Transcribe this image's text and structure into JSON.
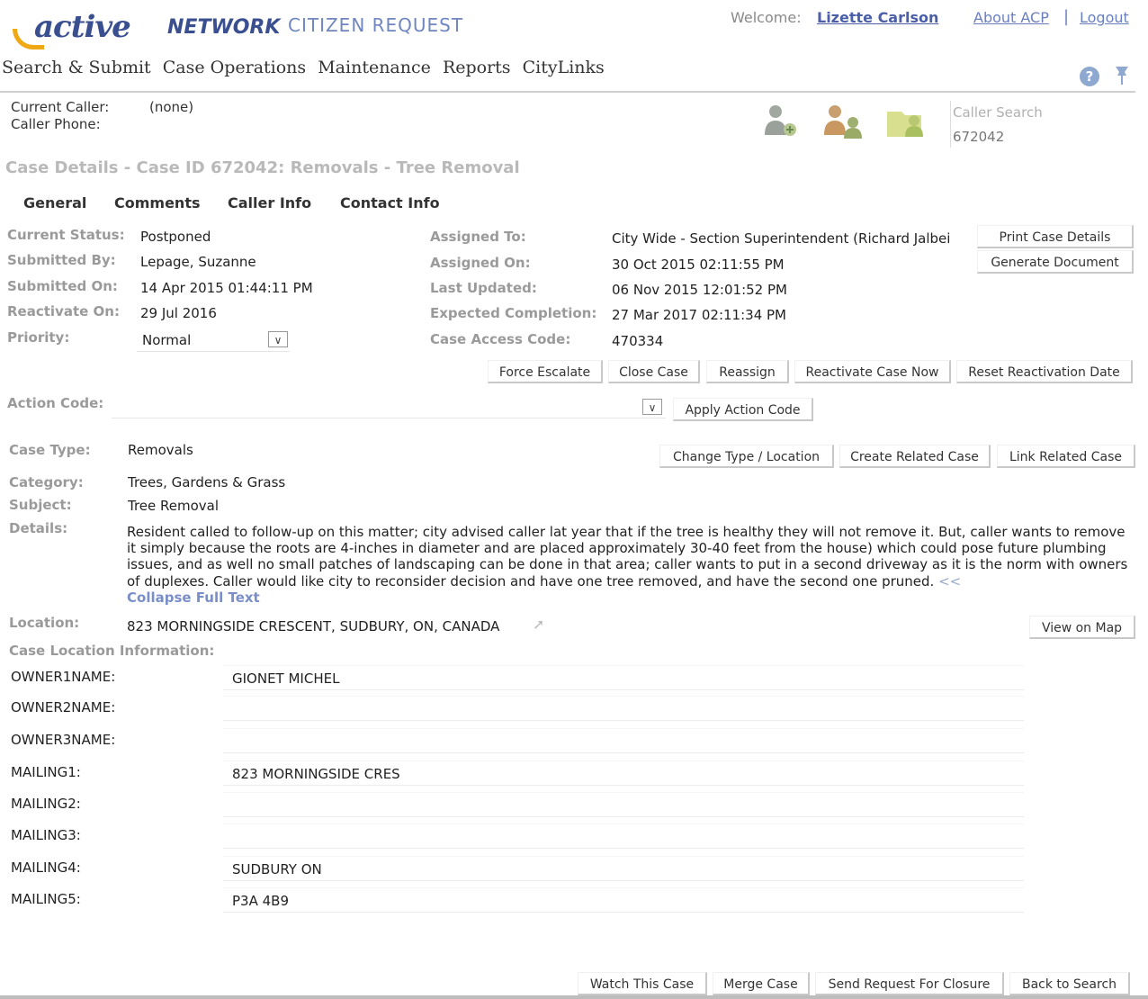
{
  "header": {
    "logo_active": "active",
    "logo_network": "NETWORK",
    "product": "CITIZEN REQUEST",
    "welcome_label": "Welcome:",
    "user_name": "Lizette Carlson",
    "about_link": "About ACP",
    "separator": "|",
    "logout_link": "Logout"
  },
  "menu": {
    "items": [
      "Search & Submit",
      "Case Operations",
      "Maintenance",
      "Reports",
      "CityLinks"
    ],
    "help_glyph": "?"
  },
  "caller": {
    "current_caller_label": "Current Caller:",
    "current_caller_value": "(none)",
    "caller_phone_label": "Caller Phone:",
    "caller_search_placeholder": "Caller Search",
    "caller_search_value": "672042"
  },
  "case": {
    "title": "Case Details - Case ID 672042: Removals - Tree Removal"
  },
  "tabs": [
    "General",
    "Comments",
    "Caller Info",
    "Contact Info"
  ],
  "fields_left": [
    {
      "label": "Current Status:",
      "value": "Postponed"
    },
    {
      "label": "Submitted By:",
      "value": "Lepage, Suzanne"
    },
    {
      "label": "Submitted On:",
      "value": "14 Apr 2015 01:44:11 PM"
    },
    {
      "label": "Reactivate On:",
      "value": "29 Jul 2016"
    },
    {
      "label": "Priority:",
      "value": "Normal"
    }
  ],
  "fields_right": [
    {
      "label": "Assigned To:",
      "value": "City Wide - Section Superintendent (Richard Jalbei"
    },
    {
      "label": "Assigned On:",
      "value": "30 Oct 2015 02:11:55 PM"
    },
    {
      "label": "Last Updated:",
      "value": "06 Nov 2015 12:01:52 PM"
    },
    {
      "label": "Expected Completion:",
      "value": "27 Mar 2017 02:11:34 PM"
    },
    {
      "label": "Case Access Code:",
      "value": "470334"
    }
  ],
  "buttons": {
    "print_case_details": "Print Case Details",
    "generate_document": "Generate Document",
    "force_escalate": "Force Escalate",
    "close_case": "Close Case",
    "reassign": "Reassign",
    "reactivate_case_now": "Reactivate Case Now",
    "reset_reactivation_date": "Reset Reactivation Date",
    "apply_action_code": "Apply Action Code",
    "change_type_location": "Change Type / Location",
    "create_related_case": "Create Related Case",
    "link_related_case": "Link Related Case",
    "view_on_map": "View on Map",
    "watch_this_case": "Watch This Case",
    "merge_case": "Merge Case",
    "send_request_for_closure": "Send Request For Closure",
    "back_to_search": "Back to Search"
  },
  "action_code": {
    "label": "Action Code:",
    "value": ""
  },
  "case_info": {
    "case_type_label": "Case Type:",
    "case_type_value": "Removals",
    "category_label": "Category:",
    "category_value": "Trees, Gardens & Grass",
    "subject_label": "Subject:",
    "subject_value": "Tree Removal",
    "details_label": "Details:",
    "details_value": "Resident called to follow-up on this matter; city advised caller lat year that if the tree is healthy they will not remove it. But, caller wants to remove it simply because the roots are 4-inches in diameter and are placed approximately 30-40 feet from the house) which could pose future plumbing issues, and as well no small patches of landscaping can be done in that area; caller wants to put in a second driveway as it is the norm with owners of duplexes. Caller would like city to reconsider decision and have one tree removed, and have the second one pruned.",
    "details_arrows": "<<",
    "collapse_link": "Collapse Full Text"
  },
  "location": {
    "label": "Location:",
    "value": "823 MORNINGSIDE CRESCENT, SUDBURY, ON, CANADA",
    "section_title": "Case Location Information:",
    "rows": [
      {
        "label": "OWNER1NAME:",
        "value": "GIONET MICHEL"
      },
      {
        "label": "OWNER2NAME:",
        "value": ""
      },
      {
        "label": "OWNER3NAME:",
        "value": ""
      },
      {
        "label": "MAILING1:",
        "value": "823 MORNINGSIDE CRES"
      },
      {
        "label": "MAILING2:",
        "value": ""
      },
      {
        "label": "MAILING3:",
        "value": ""
      },
      {
        "label": "MAILING4:",
        "value": "SUDBURY ON"
      },
      {
        "label": "MAILING5:",
        "value": "P3A 4B9"
      }
    ]
  }
}
